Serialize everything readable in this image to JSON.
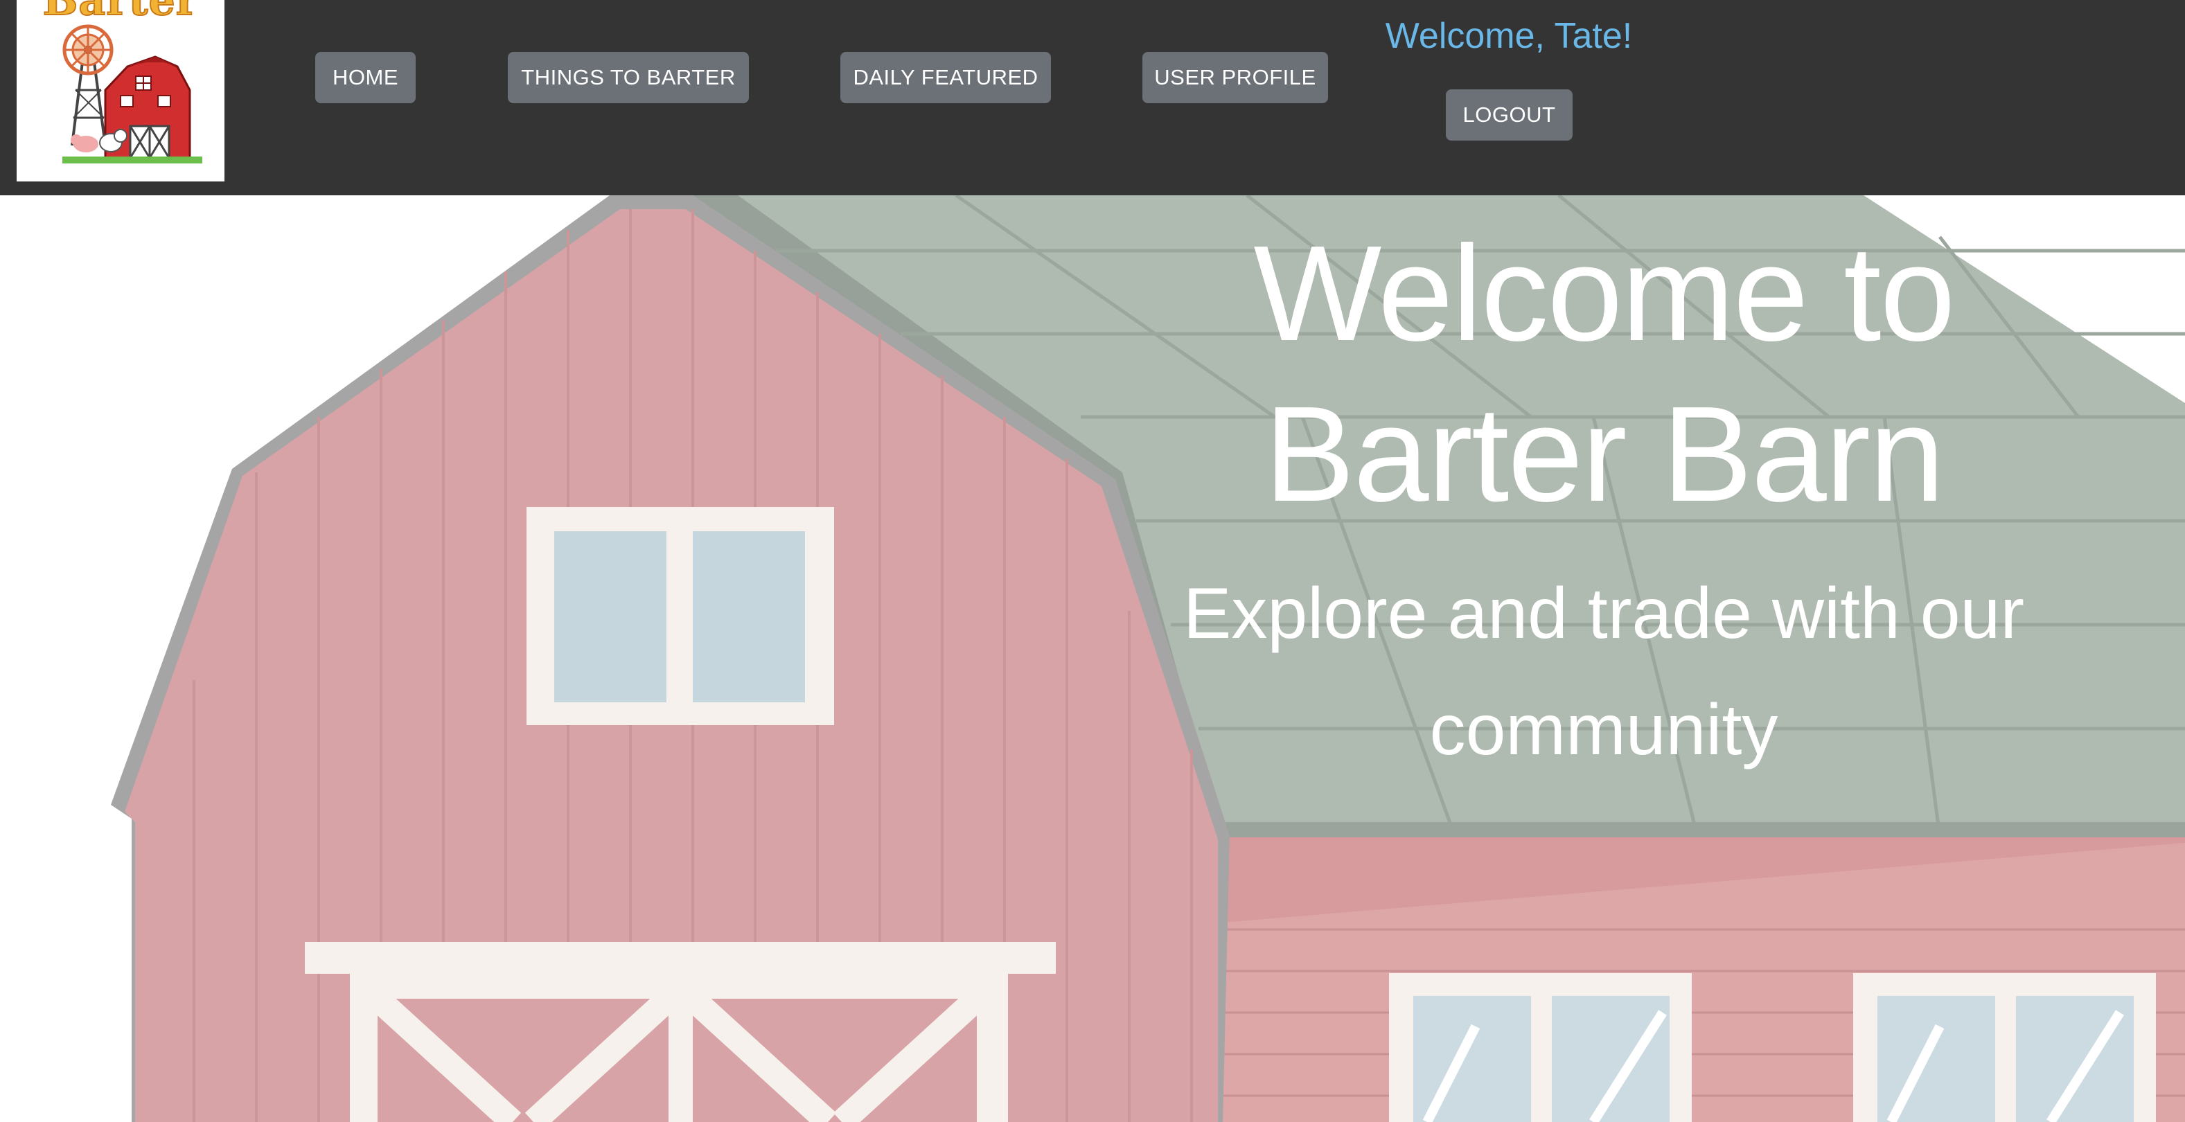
{
  "brand": {
    "logo_text": "Barter"
  },
  "nav": {
    "items": [
      {
        "label": "HOME"
      },
      {
        "label": "THINGS TO BARTER"
      },
      {
        "label": "DAILY FEATURED"
      },
      {
        "label": "USER PROFILE"
      }
    ],
    "welcome": "Welcome, Tate!",
    "logout_label": "LOGOUT"
  },
  "hero": {
    "title_line1": "Welcome to",
    "title_line2": "Barter Barn",
    "subtitle_line1": "Explore and trade with our",
    "subtitle_line2": "community"
  },
  "colors": {
    "navbar_bg": "#343434",
    "button_bg": "#6c7077",
    "welcome_text": "#6ab8e8",
    "barn_red": "#d8a3a6",
    "roof_green": "#afbab0"
  }
}
